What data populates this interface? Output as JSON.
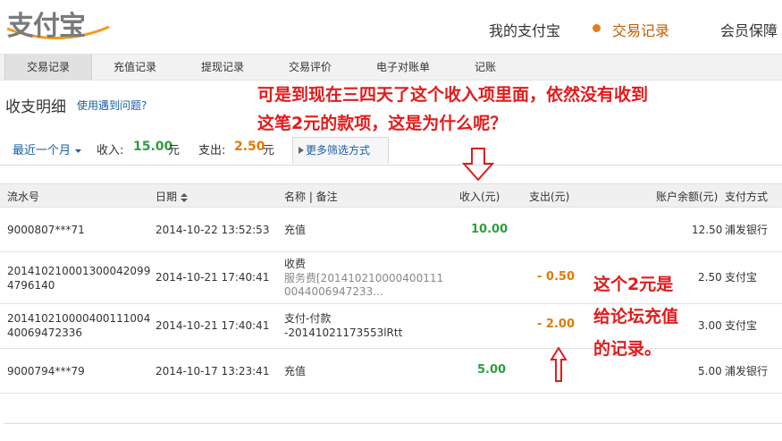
{
  "header": {
    "logo_text": "支付宝",
    "nav": [
      "我的支付宝",
      "交易记录",
      "会员保障"
    ],
    "active_nav": "交易记录"
  },
  "tabs": [
    "交易记录",
    "充值记录",
    "提现记录",
    "交易评价",
    "电子对账单",
    "记账"
  ],
  "section": {
    "title": "收支明细",
    "help_link": "使用遇到问题?"
  },
  "filter": {
    "period": "最近一个月",
    "income_label": "收入:",
    "income_value": "15.00",
    "expense_label": "支出:",
    "expense_value": "2.50",
    "currency": "元",
    "more": "更多筛选方式"
  },
  "table": {
    "columns": {
      "serial": "流水号",
      "date": "日期",
      "name": "名称 | 备注",
      "income": "收入(元)",
      "expense": "支出(元)",
      "balance": "账户余额(元)",
      "method": "支付方式"
    },
    "rows": [
      {
        "serial": "9000807***71",
        "serial2": "",
        "date": "2014-10-22 13:52:53",
        "name": "充值",
        "note": "",
        "note2": "",
        "income": "10.00",
        "expense": "",
        "balance": "12.50",
        "method": "浦发银行"
      },
      {
        "serial": "201410210001300042099",
        "serial2": "4796140",
        "date": "2014-10-21 17:40:41",
        "name": "收费",
        "note": "服务费[201410210000400111",
        "note2": "0044006947233...",
        "income": "",
        "expense": "- 0.50",
        "balance": "2.50",
        "method": "支付宝"
      },
      {
        "serial": "201410210000400111004",
        "serial2": "40069472336",
        "date": "2014-10-21 17:40:41",
        "name": "支付-付款",
        "note": "-20141021173553lRtt",
        "note2": "",
        "income": "",
        "expense": "- 2.00",
        "balance": "3.00",
        "method": "支付宝"
      },
      {
        "serial": "9000794***79",
        "serial2": "",
        "date": "2014-10-17 13:23:41",
        "name": "充值",
        "note": "",
        "note2": "",
        "income": "5.00",
        "expense": "",
        "balance": "5.00",
        "method": "浦发银行"
      }
    ]
  },
  "annotations": {
    "top_line1": "可是到现在三四天了这个收入项里面，依然没有收到",
    "top_line2": "这笔2元的款项，这是为什么呢？",
    "side_line1": "这个2元是",
    "side_line2": "给论坛充值",
    "side_line3": "的记录。"
  },
  "colors": {
    "income": "#2f9c3f",
    "expense": "#e07b00",
    "annotation": "#e21b1b",
    "link": "#1a5fa8",
    "active_nav": "#c35e00"
  },
  "icons": [
    "dropdown-caret-icon",
    "sort-icon",
    "right-triangle-icon",
    "down-arrow-annotation",
    "up-arrow-annotation"
  ]
}
